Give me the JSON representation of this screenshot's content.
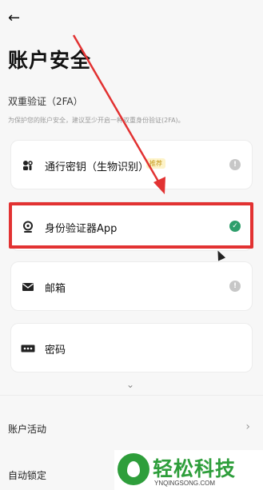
{
  "header": {
    "back_icon": "back-arrow-icon",
    "title": "账户安全"
  },
  "two_factor": {
    "title": "双重验证（2FA）",
    "description": "为保护您的账户安全，建议至少开启一种双重身份验证(2FA)。",
    "methods": [
      {
        "label": "通行密钥（生物识别）",
        "badge": "推荐",
        "icon": "passkey-icon",
        "status": "not-enabled",
        "status_icon": "!"
      },
      {
        "label": "身份验证器App",
        "icon": "authenticator-icon",
        "status": "enabled",
        "status_icon": "✓"
      },
      {
        "label": "邮箱",
        "icon": "mail-icon",
        "status": "not-enabled",
        "status_icon": "!"
      },
      {
        "label": "密码",
        "icon": "password-icon",
        "status": "none",
        "status_icon": ""
      }
    ]
  },
  "more_rows": [
    {
      "label": "账户活动",
      "chevron": "›"
    },
    {
      "label": "自动锁定",
      "chevron": ""
    }
  ],
  "expand": "⌄",
  "watermark": {
    "text": "轻松科技",
    "sub": "YNQINGSONG.COM"
  },
  "colors": {
    "highlight": "#e23232",
    "success": "#2e9e6b",
    "badge_bg": "#fdf3c9",
    "badge_text": "#c69a1c",
    "brand_green": "#2e9e3b"
  }
}
